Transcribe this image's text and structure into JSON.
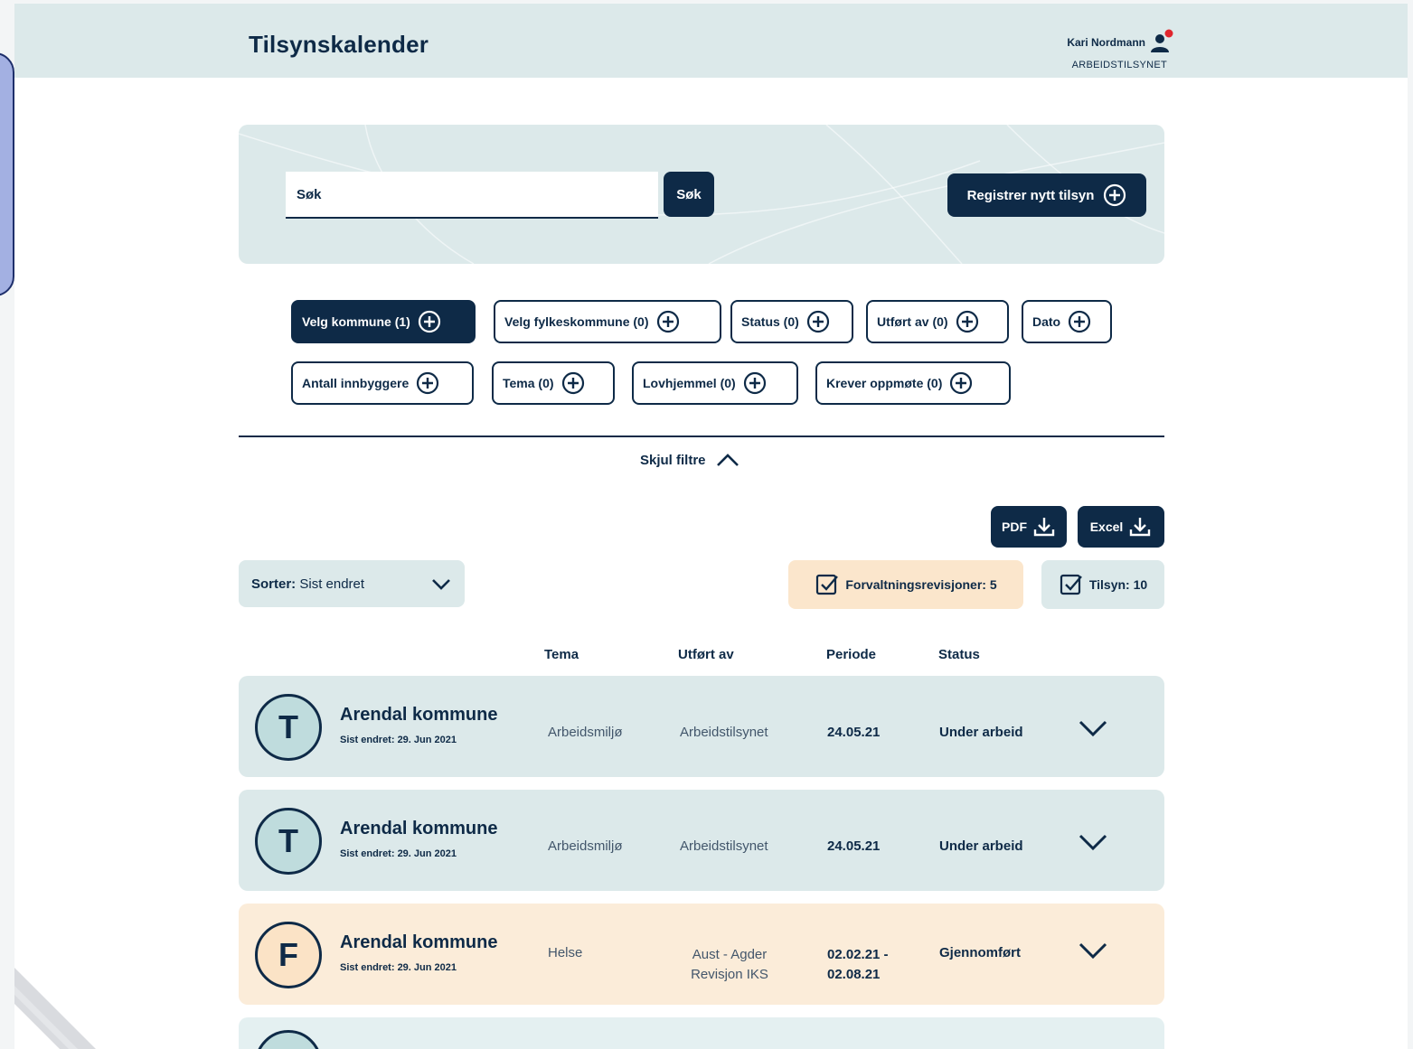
{
  "header": {
    "title": "Tilsynskalender",
    "user_name": "Kari Nordmann",
    "user_org": "ARBEIDSTILSYNET"
  },
  "search": {
    "placeholder": "Søk",
    "button_label": "Søk",
    "register_label": "Registrer nytt tilsyn"
  },
  "filters": {
    "chips": [
      "Velg kommune (1)",
      "Velg fylkeskommune (0)",
      "Status (0)",
      "Utført av (0)",
      "Dato",
      "Antall innbyggere",
      "Tema (0)",
      "Lovhjemmel (0)",
      "Krever oppmøte (0)"
    ],
    "hide_label": "Skjul filtre"
  },
  "export": {
    "pdf_label": "PDF",
    "excel_label": "Excel"
  },
  "sort": {
    "label": "Sorter:",
    "value": "Sist endret"
  },
  "counts": {
    "forvaltning": "Forvaltningsrevisjoner: 5",
    "tilsyn": "Tilsyn: 10"
  },
  "columns": {
    "tema": "Tema",
    "utfort_av": "Utført av",
    "periode": "Periode",
    "status": "Status"
  },
  "rows": [
    {
      "letter": "T",
      "name": "Arendal kommune",
      "updated": "Sist endret: 29. Jun 2021",
      "tema": "Arbeidsmiljø",
      "utfort_av": "Arbeidstilsynet",
      "periode": "24.05.21",
      "status": "Under arbeid"
    },
    {
      "letter": "T",
      "name": "Arendal kommune",
      "updated": "Sist endret: 29. Jun 2021",
      "tema": "Arbeidsmiljø",
      "utfort_av": "Arbeidstilsynet",
      "periode": "24.05.21",
      "status": "Under arbeid"
    },
    {
      "letter": "F",
      "name": "Arendal kommune",
      "updated": "Sist endret: 29. Jun 2021",
      "tema": "Helse",
      "utfort_av_1": "Aust - Agder",
      "utfort_av_2": "Revisjon IKS",
      "periode_1": "02.02.21 -",
      "periode_2": "02.08.21",
      "status": "Gjennomført"
    }
  ],
  "colors": {
    "navy": "#0e2a47",
    "header_bg": "#dce9ea",
    "tilsyn_bg": "#dce9ea",
    "forvaltning_bg": "#fbecd9",
    "notification": "#e0262e"
  },
  "icons": [
    "user-icon",
    "plus-circle-icon",
    "chevron-up-icon",
    "download-icon",
    "chevron-down-icon",
    "checkbox-icon"
  ]
}
